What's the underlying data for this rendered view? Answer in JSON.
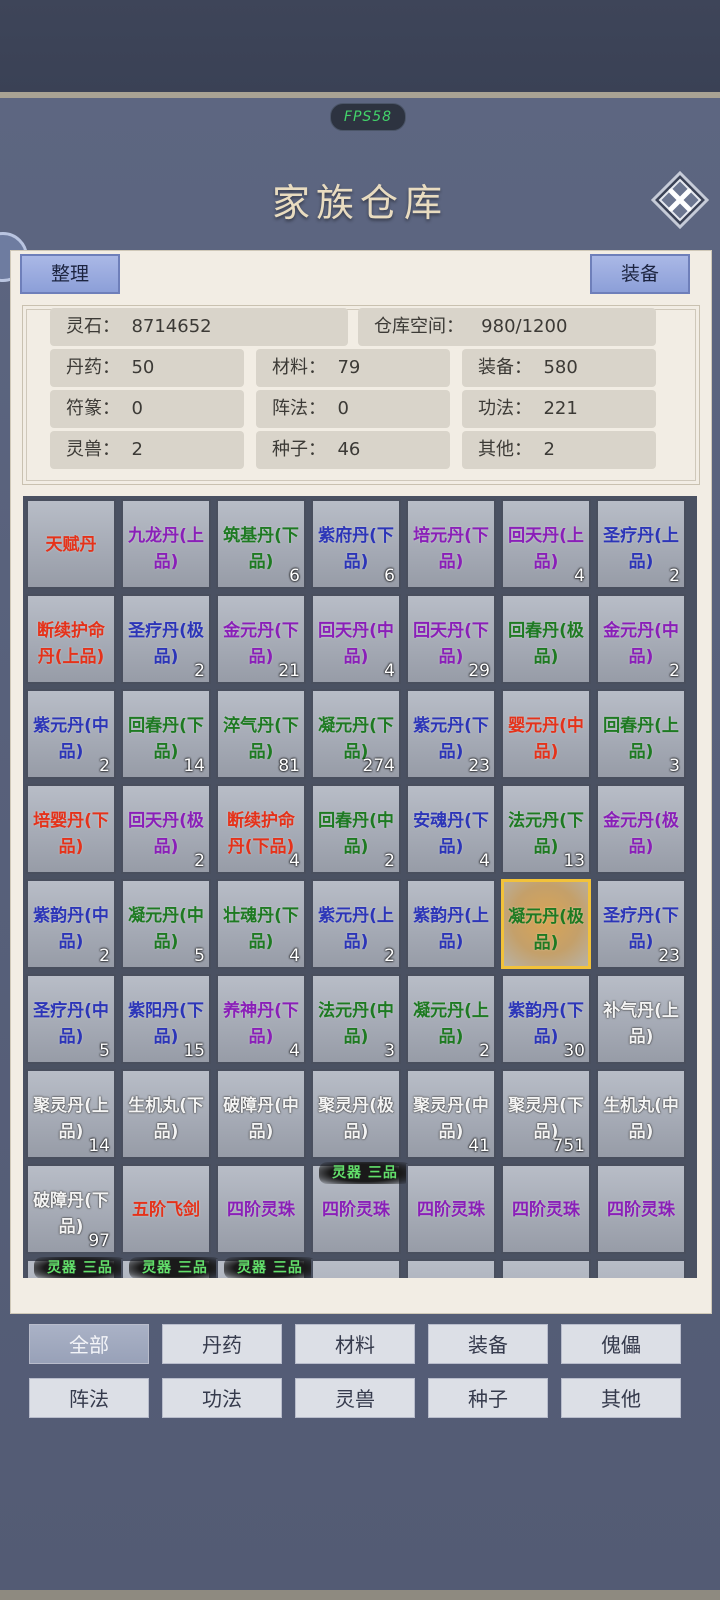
{
  "hud": {
    "fps": "FPS58"
  },
  "header": {
    "title": "家族仓库"
  },
  "buttons": {
    "sort": "整理",
    "equip": "装备"
  },
  "stats": {
    "spirit_stone": "灵石：  8714652",
    "space": "仓库空间：   980/1200",
    "rows": [
      [
        "丹药：  50",
        "材料：  79",
        "装备：  580"
      ],
      [
        "符篆：  0",
        "阵法：  0",
        "功法：  221"
      ],
      [
        "灵兽：  2",
        "种子：  46",
        "其他：  2"
      ]
    ]
  },
  "item_tag": "灵器 三品",
  "items": [
    {
      "name": "天赋丹",
      "count": "",
      "color": "#e5321a"
    },
    {
      "name": "九龙丹(上品)",
      "count": "",
      "color": "#8a1fb8"
    },
    {
      "name": "筑基丹(下品)",
      "count": "6",
      "color": "#1e7a22"
    },
    {
      "name": "紫府丹(下品)",
      "count": "6",
      "color": "#2c35b8"
    },
    {
      "name": "培元丹(下品)",
      "count": "",
      "color": "#8a1fb8"
    },
    {
      "name": "回天丹(上品)",
      "count": "4",
      "color": "#8a1fb8"
    },
    {
      "name": "圣疗丹(上品)",
      "count": "2",
      "color": "#2c35b8"
    },
    {
      "name": "断续护命丹(上品)",
      "count": "",
      "color": "#e5321a"
    },
    {
      "name": "圣疗丹(极品)",
      "count": "2",
      "color": "#2c35b8"
    },
    {
      "name": "金元丹(下品)",
      "count": "21",
      "color": "#8a1fb8"
    },
    {
      "name": "回天丹(中品)",
      "count": "4",
      "color": "#8a1fb8"
    },
    {
      "name": "回天丹(下品)",
      "count": "29",
      "color": "#8a1fb8"
    },
    {
      "name": "回春丹(极品)",
      "count": "",
      "color": "#1e7a22"
    },
    {
      "name": "金元丹(中品)",
      "count": "2",
      "color": "#8a1fb8"
    },
    {
      "name": "紫元丹(中品)",
      "count": "2",
      "color": "#2c35b8"
    },
    {
      "name": "回春丹(下品)",
      "count": "14",
      "color": "#1e7a22"
    },
    {
      "name": "淬气丹(下品)",
      "count": "81",
      "color": "#1e7a22"
    },
    {
      "name": "凝元丹(下品)",
      "count": "274",
      "color": "#1e7a22"
    },
    {
      "name": "紫元丹(下品)",
      "count": "23",
      "color": "#2c35b8"
    },
    {
      "name": "婴元丹(中品)",
      "count": "",
      "color": "#e5321a"
    },
    {
      "name": "回春丹(上品)",
      "count": "3",
      "color": "#1e7a22"
    },
    {
      "name": "培婴丹(下品)",
      "count": "",
      "color": "#e5321a"
    },
    {
      "name": "回天丹(极品)",
      "count": "2",
      "color": "#8a1fb8"
    },
    {
      "name": "断续护命丹(下品)",
      "count": "4",
      "color": "#e5321a"
    },
    {
      "name": "回春丹(中品)",
      "count": "2",
      "color": "#1e7a22"
    },
    {
      "name": "安魂丹(下品)",
      "count": "4",
      "color": "#2c35b8"
    },
    {
      "name": "法元丹(下品)",
      "count": "13",
      "color": "#1e7a22"
    },
    {
      "name": "金元丹(极品)",
      "count": "",
      "color": "#8a1fb8"
    },
    {
      "name": "紫韵丹(中品)",
      "count": "2",
      "color": "#2c35b8"
    },
    {
      "name": "凝元丹(中品)",
      "count": "5",
      "color": "#1e7a22"
    },
    {
      "name": "壮魂丹(下品)",
      "count": "4",
      "color": "#1e7a22"
    },
    {
      "name": "紫元丹(上品)",
      "count": "2",
      "color": "#2c35b8"
    },
    {
      "name": "紫韵丹(上品)",
      "count": "",
      "color": "#2c35b8"
    },
    {
      "name": "凝元丹(极品)",
      "count": "",
      "color": "#1e7a22",
      "selected": true
    },
    {
      "name": "圣疗丹(下品)",
      "count": "23",
      "color": "#2c35b8"
    },
    {
      "name": "圣疗丹(中品)",
      "count": "5",
      "color": "#2c35b8"
    },
    {
      "name": "紫阳丹(下品)",
      "count": "15",
      "color": "#2c35b8"
    },
    {
      "name": "养神丹(下品)",
      "count": "4",
      "color": "#8a1fb8"
    },
    {
      "name": "法元丹(中品)",
      "count": "3",
      "color": "#1e7a22"
    },
    {
      "name": "凝元丹(上品)",
      "count": "2",
      "color": "#1e7a22"
    },
    {
      "name": "紫韵丹(下品)",
      "count": "30",
      "color": "#2c35b8"
    },
    {
      "name": "补气丹(上品)",
      "count": "",
      "color": "#f4f4f4"
    },
    {
      "name": "聚灵丹(上品)",
      "count": "14",
      "color": "#f4f4f4"
    },
    {
      "name": "生机丸(下品)",
      "count": "",
      "color": "#f4f4f4"
    },
    {
      "name": "破障丹(中品)",
      "count": "",
      "color": "#f4f4f4"
    },
    {
      "name": "聚灵丹(极品)",
      "count": "",
      "color": "#f4f4f4"
    },
    {
      "name": "聚灵丹(中品)",
      "count": "41",
      "color": "#f4f4f4"
    },
    {
      "name": "聚灵丹(下品)",
      "count": "751",
      "color": "#f4f4f4"
    },
    {
      "name": "生机丸(中品)",
      "count": "",
      "color": "#f4f4f4"
    },
    {
      "name": "破障丹(下品)",
      "count": "97",
      "color": "#f4f4f4"
    },
    {
      "name": "五阶飞剑",
      "count": "",
      "color": "#e5321a"
    },
    {
      "name": "四阶灵珠",
      "count": "",
      "color": "#8a1fb8"
    },
    {
      "name": "四阶灵珠",
      "count": "",
      "color": "#8a1fb8",
      "tag": true
    },
    {
      "name": "四阶灵珠",
      "count": "",
      "color": "#8a1fb8"
    },
    {
      "name": "四阶灵珠",
      "count": "",
      "color": "#8a1fb8"
    },
    {
      "name": "四阶灵珠",
      "count": "",
      "color": "#8a1fb8"
    },
    {
      "name": "",
      "count": "",
      "color": "#8a1fb8",
      "tag": true
    },
    {
      "name": "",
      "count": "",
      "color": "#8a1fb8",
      "tag": true
    },
    {
      "name": "",
      "count": "",
      "color": "#8a1fb8",
      "tag": true
    },
    {
      "name": "",
      "count": "",
      "color": "#8a1fb8"
    },
    {
      "name": "",
      "count": "",
      "color": "#8a1fb8"
    },
    {
      "name": "",
      "count": "",
      "color": "#8a1fb8"
    },
    {
      "name": "",
      "count": "",
      "color": "#8a1fb8"
    }
  ],
  "tabs": [
    {
      "label": "全部",
      "active": true
    },
    {
      "label": "丹药"
    },
    {
      "label": "材料"
    },
    {
      "label": "装备"
    },
    {
      "label": "傀儡"
    },
    {
      "label": "阵法"
    },
    {
      "label": "功法"
    },
    {
      "label": "灵兽"
    },
    {
      "label": "种子"
    },
    {
      "label": "其他"
    }
  ]
}
